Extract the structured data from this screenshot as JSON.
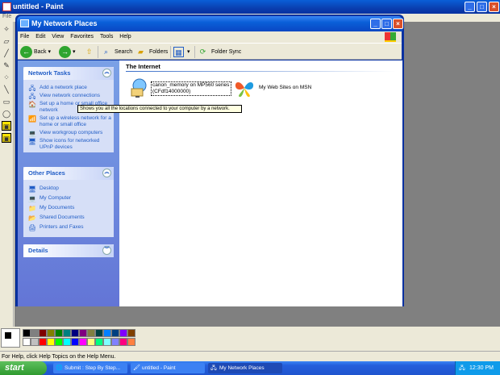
{
  "paint": {
    "title": "untitled - Paint",
    "menu_first": "File",
    "status": "For Help, click Help Topics on the Help Menu.",
    "palette_colors": [
      "#000000",
      "#808080",
      "#800000",
      "#808000",
      "#008000",
      "#008080",
      "#000080",
      "#800080",
      "#808040",
      "#004040",
      "#0080ff",
      "#004080",
      "#8000ff",
      "#804000",
      "#ffffff",
      "#c0c0c0",
      "#ff0000",
      "#ffff00",
      "#00ff00",
      "#00ffff",
      "#0000ff",
      "#ff00ff",
      "#ffff80",
      "#00ff80",
      "#80ffff",
      "#8080ff",
      "#ff0080",
      "#ff8040"
    ]
  },
  "explorer": {
    "title": "My Network Places",
    "menu": [
      "File",
      "Edit",
      "View",
      "Favorites",
      "Tools",
      "Help"
    ],
    "toolbar": {
      "back": "Back",
      "search": "Search",
      "folders": "Folders",
      "folder_sync": "Folder Sync"
    },
    "network_tasks": {
      "title": "Network Tasks",
      "items": [
        "Add a network place",
        "View network connections",
        "Set up a home or small office network",
        "Set up a wireless network for a home or small office",
        "View workgroup computers",
        "Show icons for networked UPnP devices"
      ]
    },
    "other_places": {
      "title": "Other Places",
      "items": [
        "Desktop",
        "My Computer",
        "My Documents",
        "Shared Documents",
        "Printers and Faxes"
      ]
    },
    "details": {
      "title": "Details"
    },
    "tooltip": "Shows you all the locations connected to your computer by a network.",
    "group_title": "The Internet",
    "items": [
      {
        "label": "canon_memory on MP560 series (CFdf14000000)"
      },
      {
        "label": "My Web Sites on MSN"
      }
    ]
  },
  "taskbar": {
    "start": "start",
    "tasks": [
      "Submit : Step By Step...",
      "untitled - Paint",
      "My Network Places"
    ],
    "clock": "12:30 PM"
  }
}
